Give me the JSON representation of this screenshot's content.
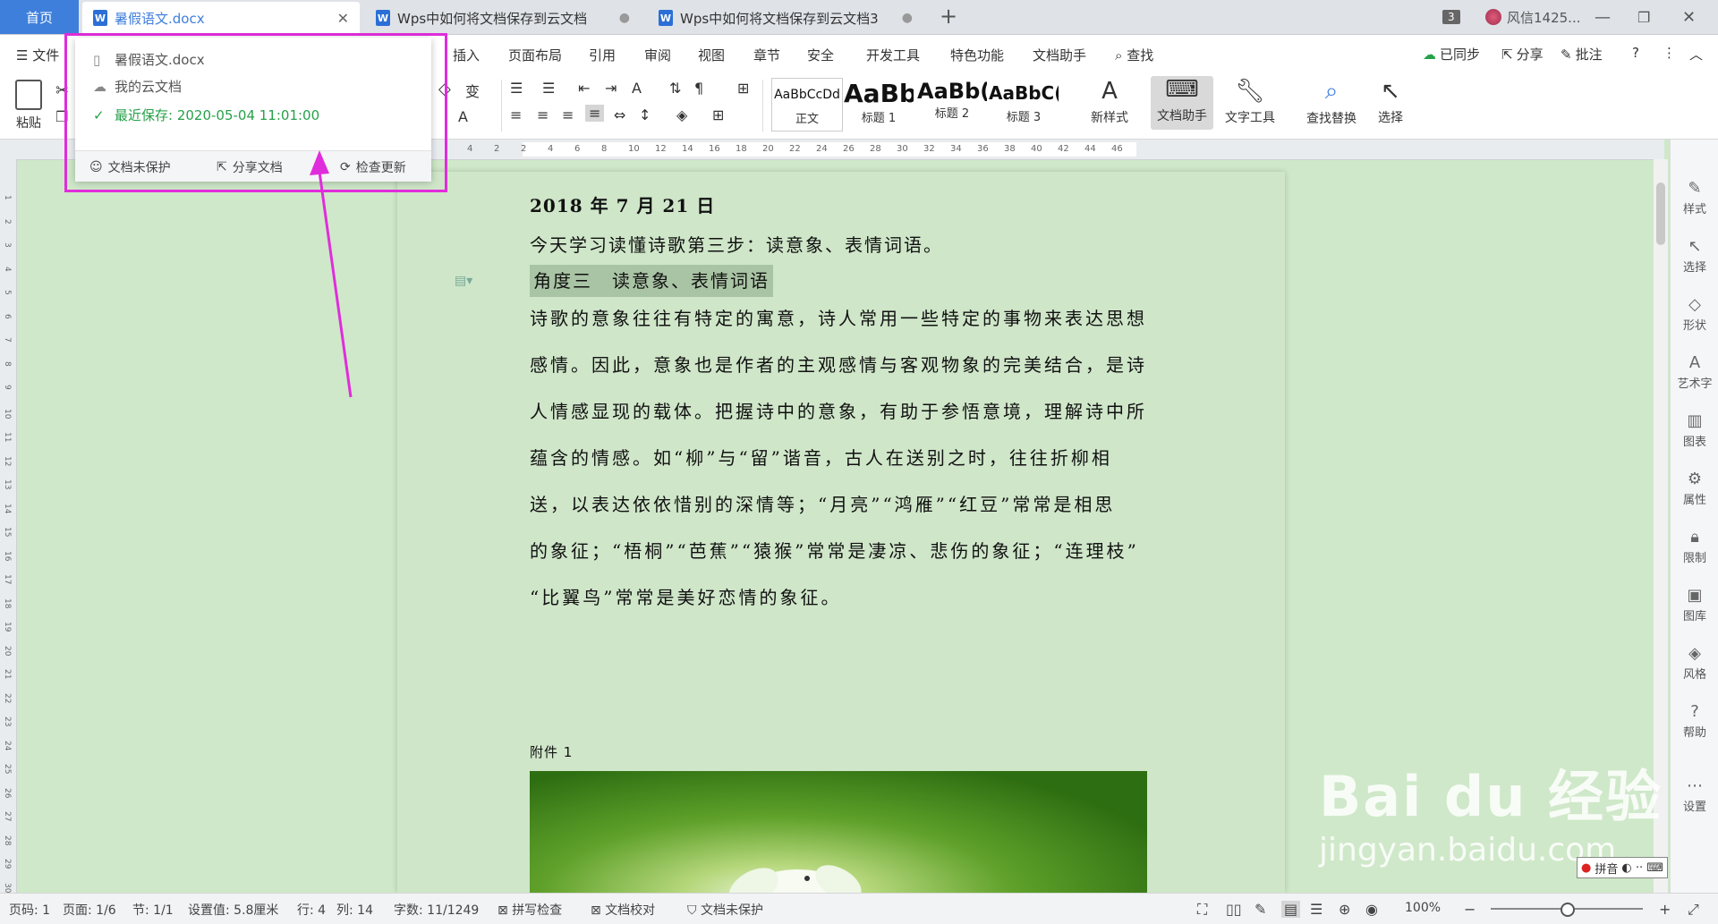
{
  "tabs": {
    "home": "首页",
    "items": [
      {
        "label": "暑假语文.docx",
        "active": true
      },
      {
        "label": "Wps中如何将文档保存到云文档",
        "active": false
      },
      {
        "label": "Wps中如何将文档保存到云文档3",
        "active": false
      }
    ],
    "window_count": "3",
    "user": "风信1425..."
  },
  "menu": {
    "file": "文件",
    "items": [
      "插入",
      "页面布局",
      "引用",
      "审阅",
      "视图",
      "章节",
      "安全",
      "开发工具",
      "特色功能",
      "文档助手"
    ],
    "search": "查找",
    "synced": "已同步",
    "share": "分享",
    "annotate": "批注"
  },
  "ribbon": {
    "paste": "粘贴",
    "styles": [
      {
        "preview": "AaBbCcDd",
        "label": "正文"
      },
      {
        "preview": "AaBb",
        "label": "标题 1"
      },
      {
        "preview": "AaBb(",
        "label": "标题 2"
      },
      {
        "preview": "AaBbC(",
        "label": "标题 3"
      }
    ],
    "new_style": "新样式",
    "doc_assistant": "文档助手",
    "text_tools": "文字工具",
    "find_replace": "查找替换",
    "select": "选择"
  },
  "popup": {
    "filename": "暑假语文.docx",
    "location": "我的云文档",
    "last_saved": "最近保存: 2020-05-04 11:01:00",
    "unprotected": "文档未保护",
    "share_doc": "分享文档",
    "check_update": "检查更新"
  },
  "ruler": {
    "ticks": [
      "4",
      "2",
      "2",
      "4",
      "6",
      "8",
      "10",
      "12",
      "14",
      "16",
      "18",
      "20",
      "22",
      "24",
      "26",
      "28",
      "30",
      "32",
      "34",
      "36",
      "38",
      "40",
      "42",
      "44",
      "46"
    ],
    "vticks": [
      "1",
      "2",
      "3",
      "4",
      "5",
      "6",
      "7",
      "8",
      "9",
      "10",
      "11",
      "12",
      "13",
      "14",
      "15",
      "16",
      "17",
      "18",
      "19",
      "20",
      "21",
      "22",
      "23",
      "24",
      "25",
      "26",
      "27",
      "28",
      "29",
      "30"
    ]
  },
  "document": {
    "date": "2018 年 7 月 21 日",
    "intro": "今天学习读懂诗歌第三步：读意象、表情词语。",
    "heading": "角度三　读意象、表情词语",
    "lines": [
      "诗歌的意象往往有特定的寓意，诗人常用一些特定的事物来表达思想",
      "感情。因此，意象也是作者的主观感情与客观物象的完美结合，是诗",
      "人情感显现的载体。把握诗中的意象，有助于参悟意境，理解诗中所",
      "蕴含的情感。如“柳”与“留”谐音，古人在送别之时，往往折柳相",
      "送，以表达依依惜别的深情等；“月亮”“鸿雁”“红豆”常常是相思",
      "的象征；“梧桐”“芭蕉”“猿猴”常常是凄凉、悲伤的象征；“连理枝”",
      "“比翼鸟”常常是美好恋情的象征。"
    ],
    "attachment": "附件 1"
  },
  "sidebar": [
    "样式",
    "选择",
    "形状",
    "艺术字",
    "图表",
    "属性",
    "限制",
    "图库",
    "风格",
    "帮助",
    "设置"
  ],
  "status": {
    "page_num": "页码: 1",
    "pages": "页面: 1/6",
    "section": "节: 1/1",
    "setting": "设置值: 5.8厘米",
    "row": "行: 4",
    "col": "列: 14",
    "words": "字数: 11/1249",
    "spell": "拼写检查",
    "proof": "文档校对",
    "protect": "文档未保护",
    "zoom": "100%"
  },
  "watermark": {
    "logo": "Bai du 经验",
    "url": "jingyan.baidu.com",
    "ime": "拼音"
  },
  "colors": {
    "accent": "#3e7fdc",
    "highlight_frame": "#e02ddb",
    "saved_green": "#27a149",
    "page_bg": "#cfe6c9"
  }
}
